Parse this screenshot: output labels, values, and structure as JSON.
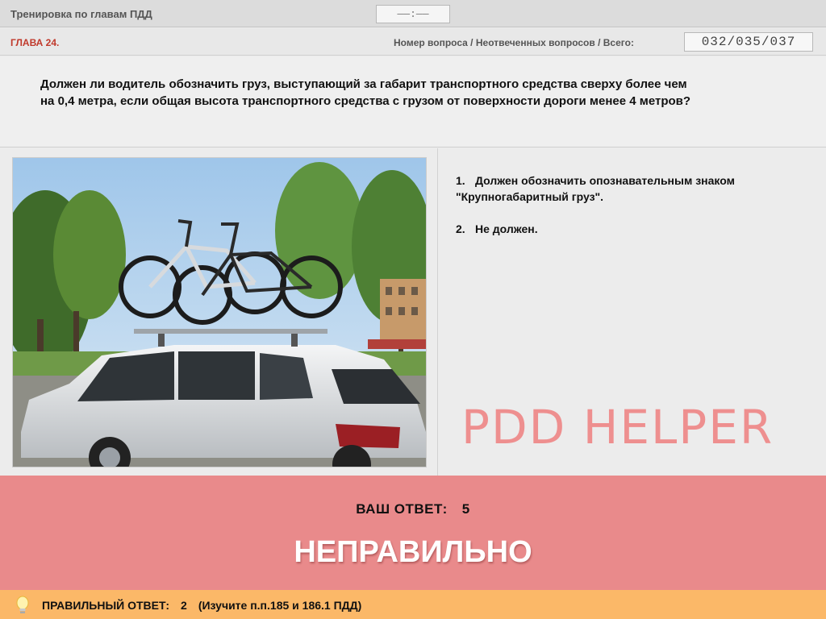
{
  "header": {
    "title": "Тренировка по главам ПДД",
    "timer": "——:——"
  },
  "chapter": {
    "label": "ГЛАВА 24.",
    "counter_label": "Номер вопроса / Неотвеченных вопросов / Всего:",
    "counter_value": "032/035/037"
  },
  "question": {
    "text": "Должен ли водитель обозначить груз, выступающий за габарит транспортного средства сверху более чем на 0,4 метра, если общая высота транспортного средства с грузом от поверхности дороги менее 4 метров?"
  },
  "answers": [
    {
      "num": "1.",
      "text": "Должен обозначить опознавательным знаком \"Крупногабаритный груз\"."
    },
    {
      "num": "2.",
      "text": "Не должен."
    }
  ],
  "watermark": "PDD HELPER",
  "result": {
    "your_answer_label": "ВАШ ОТВЕТ:",
    "your_answer_value": "5",
    "verdict": "НЕПРАВИЛЬНО"
  },
  "correct": {
    "label": "ПРАВИЛЬНЫЙ ОТВЕТ:",
    "value": "2",
    "note": "(Изучите п.п.185 и 186.1 ПДД)"
  },
  "colors": {
    "result_bg": "#e98a8b",
    "correct_bg": "#fbb868",
    "chapter_red": "#c0392b",
    "watermark": "#ee8f8f"
  },
  "icons": {
    "hint": "lightbulb-icon"
  }
}
